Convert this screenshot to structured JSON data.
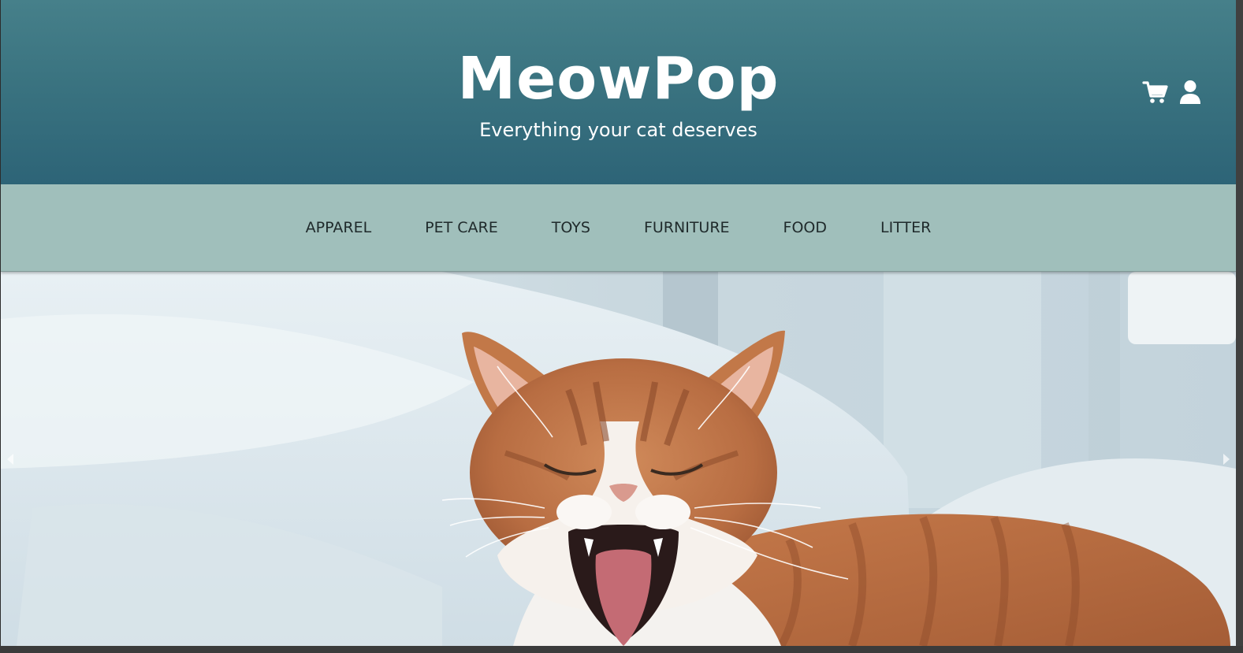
{
  "header": {
    "brand": "MeowPop",
    "tagline": "Everything your cat deserves",
    "icons": [
      "cart-icon",
      "user-icon"
    ],
    "colors": {
      "top": "#46808a",
      "bottom": "#2d6477",
      "text": "#ffffff"
    }
  },
  "nav": {
    "items": [
      {
        "label": "APPAREL"
      },
      {
        "label": "PET CARE"
      },
      {
        "label": "TOYS"
      },
      {
        "label": "FURNITURE"
      },
      {
        "label": "FOOD"
      },
      {
        "label": "LITTER"
      }
    ],
    "background": "#a0bfbb"
  },
  "hero": {
    "image": "orange-and-white-cat-yawning-on-bed",
    "controls": [
      "chevron-left-icon",
      "chevron-right-icon"
    ]
  }
}
